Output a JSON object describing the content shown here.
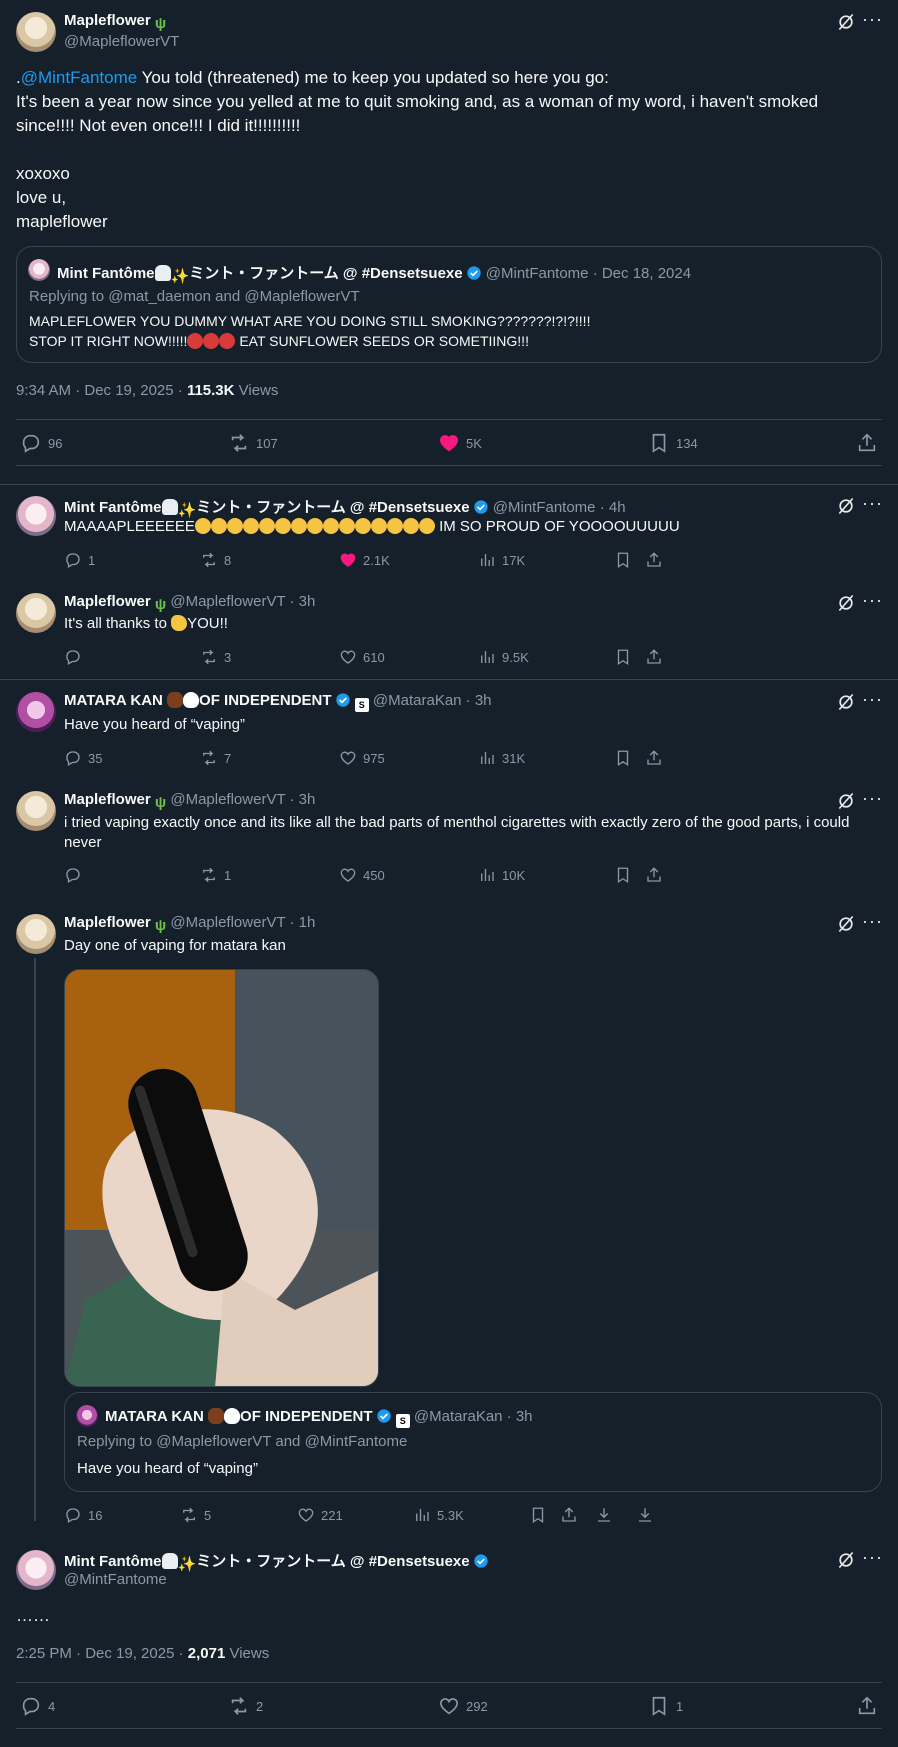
{
  "main_tweet": {
    "author_name": "Mapleflower",
    "author_handle": "@MapleflowerVT",
    "mention": "@MintFantome",
    "text_prefix": ".",
    "text_line1_rest": " You told (threatened) me to keep you updated so here you go:",
    "text_rest": "It's been a year now since you yelled at me to quit smoking and, as a woman of my word, i haven't smoked\nsince!!!! Not even once!!! I did it!!!!!!!!!!\n\nxoxoxo\nlove u,\nmapleflower",
    "quote": {
      "name": "Mint Fantôme",
      "name_jp": "ミント・ファントーム @ #Densetsuexe",
      "handle_time": "@MintFantome · Dec 18, 2024",
      "replying": "Replying to @mat_daemon and @MapleflowerVT",
      "line1": "MAPLEFLOWER YOU DUMMY WHAT ARE YOU DOING STILL SMOKING???????!?!?!!!!",
      "line2_a": "STOP IT RIGHT NOW!!!!!",
      "line2_b": " EAT SUNFLOWER SEEDS OR SOMETIING!!!"
    },
    "meta_time": "9:34 AM · Dec 19, 2025 · ",
    "meta_views_count": "115.3K",
    "meta_views_label": " Views",
    "stats": {
      "replies": "96",
      "reposts": "107",
      "likes": "5K",
      "bookmarks": "134"
    }
  },
  "replies": [
    {
      "name": "Mint Fantôme",
      "name_jp": "ミント・ファントーム @ #Densetsuexe",
      "handle_time": "@MintFantome · 4h",
      "text_a": "MAAAAPLEEEEEE",
      "text_b": " IM SO PROUD OF YOOOOUUUUU",
      "stats": {
        "replies": "1",
        "reposts": "8",
        "likes": "2.1K",
        "views": "17K"
      }
    },
    {
      "name": "Mapleflower",
      "handle_time": "@MapleflowerVT · 3h",
      "text_a": "It's all thanks to ",
      "text_b": "YOU!!",
      "stats": {
        "replies": "",
        "reposts": "3",
        "likes": "610",
        "views": "9.5K"
      }
    },
    {
      "name": "MATARA KAN",
      "name_tail": "OF INDEPENDENT",
      "handle_time": "@MataraKan · 3h",
      "text": "Have you heard of “vaping”",
      "stats": {
        "replies": "35",
        "reposts": "7",
        "likes": "975",
        "views": "31K"
      }
    },
    {
      "name": "Mapleflower",
      "handle_time": "@MapleflowerVT · 3h",
      "text": "i tried vaping exactly once and its like all the bad parts of menthol cigarettes with exactly zero of the good parts, i could never",
      "stats": {
        "replies": "",
        "reposts": "1",
        "likes": "450",
        "views": "10K"
      }
    },
    {
      "name": "Mapleflower",
      "handle_time": "@MapleflowerVT · 1h",
      "text": "Day one of vaping for matara kan",
      "quote": {
        "name": "MATARA KAN",
        "name_tail": "OF INDEPENDENT",
        "handle_time": "@MataraKan · 3h",
        "replying": "Replying to @MapleflowerVT and @MintFantome",
        "text": "Have you heard of “vaping”"
      },
      "stats": {
        "replies": "16",
        "reposts": "5",
        "likes": "221",
        "views": "5.3K"
      }
    }
  ],
  "last_tweet": {
    "name": "Mint Fantôme",
    "name_jp": "ミント・ファントーム @ #Densetsuexe",
    "handle": "@MintFantome",
    "text": "……",
    "meta_time": "2:25 PM · Dec 19, 2025 · ",
    "meta_views_count": "2,071",
    "meta_views_label": " Views",
    "stats": {
      "replies": "4",
      "reposts": "2",
      "likes": "292",
      "bookmarks": "1"
    }
  }
}
